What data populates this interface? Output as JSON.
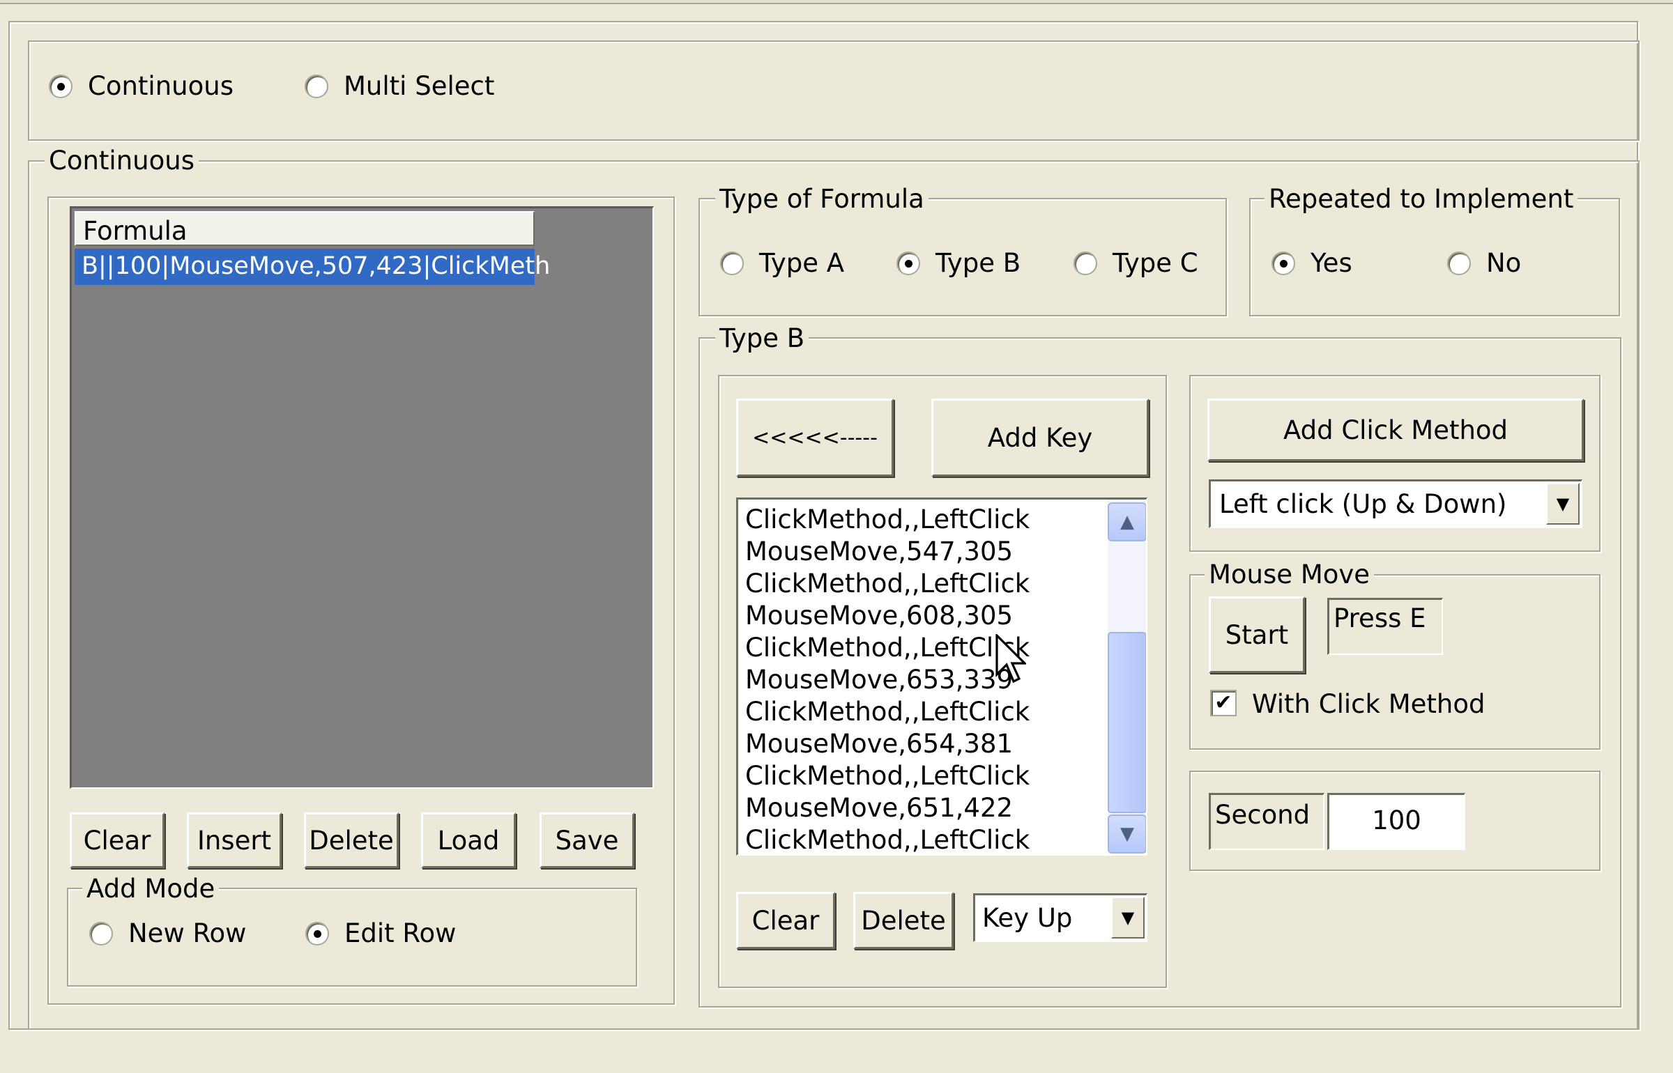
{
  "mode": {
    "options": [
      {
        "label": "Continuous",
        "selected": true
      },
      {
        "label": "Multi Select",
        "selected": false
      }
    ]
  },
  "continuous": {
    "group_label": "Continuous",
    "formula_list": {
      "header": "Formula",
      "selected_row": "B||100|MouseMove,507,423|ClickMeth"
    },
    "buttons": {
      "clear": "Clear",
      "insert": "Insert",
      "delete": "Delete",
      "load": "Load",
      "save": "Save"
    },
    "add_mode": {
      "label": "Add Mode",
      "options": [
        {
          "label": "New Row",
          "selected": false
        },
        {
          "label": "Edit Row",
          "selected": true
        }
      ]
    }
  },
  "type_of_formula": {
    "label": "Type of Formula",
    "options": [
      {
        "label": "Type A",
        "selected": false
      },
      {
        "label": "Type B",
        "selected": true
      },
      {
        "label": "Type C",
        "selected": false
      }
    ]
  },
  "repeated": {
    "label": "Repeated to Implement",
    "options": [
      {
        "label": "Yes",
        "selected": true
      },
      {
        "label": "No",
        "selected": false
      }
    ]
  },
  "type_b": {
    "label": "Type B",
    "back_button": "<<<<<-----",
    "add_key_button": "Add Key",
    "steps": [
      "ClickMethod,,LeftClick",
      "MouseMove,547,305",
      "ClickMethod,,LeftClick",
      "MouseMove,608,305",
      "ClickMethod,,LeftClick",
      "MouseMove,653,339",
      "ClickMethod,,LeftClick",
      "MouseMove,654,381",
      "ClickMethod,,LeftClick",
      "MouseMove,651,422",
      "ClickMethod,,LeftClick"
    ],
    "clear_button": "Clear",
    "delete_button": "Delete",
    "key_select": {
      "value": "Key Up"
    },
    "add_click_method_button": "Add Click Method",
    "click_method_select": {
      "value": "Left click (Up & Down)"
    },
    "mouse_move": {
      "label": "Mouse Move",
      "start_button": "Start",
      "hint": "Press E",
      "with_click_method": {
        "label": "With Click Method",
        "checked": true
      }
    },
    "second": {
      "label": "Second",
      "value": "100"
    }
  },
  "colors": {
    "face": "#ece9d8",
    "selection": "#316ac5",
    "list_background": "#808080"
  }
}
